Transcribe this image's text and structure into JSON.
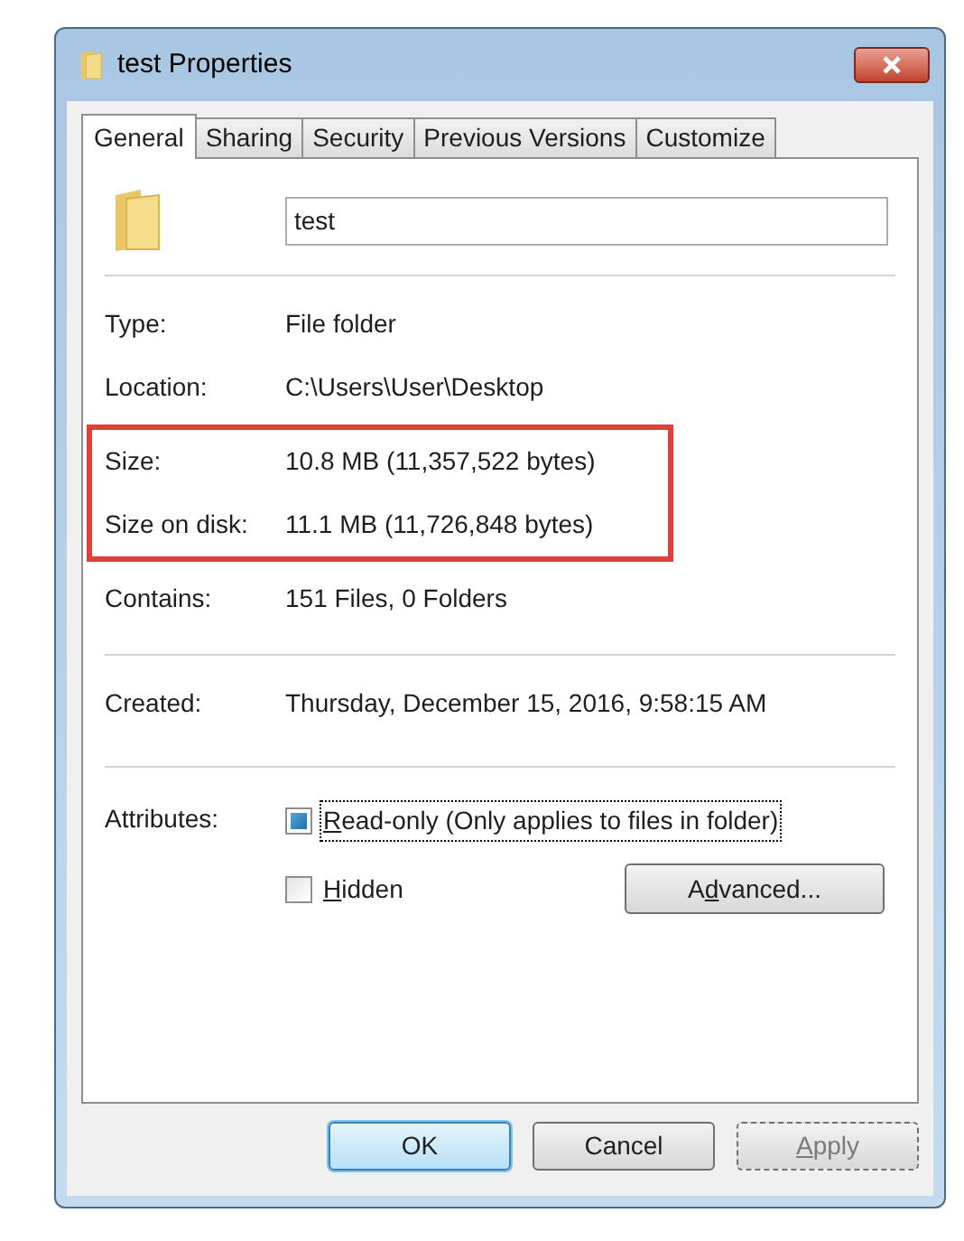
{
  "window": {
    "title": "test Properties"
  },
  "tabs": [
    {
      "label": "General",
      "selected": true
    },
    {
      "label": "Sharing",
      "selected": false
    },
    {
      "label": "Security",
      "selected": false
    },
    {
      "label": "Previous Versions",
      "selected": false
    },
    {
      "label": "Customize",
      "selected": false
    }
  ],
  "name_field": {
    "value": "test"
  },
  "sections": [
    {
      "highlight_groups": [
        {
          "highlighted": false,
          "rows": [
            {
              "label": "Type:",
              "value": "File folder"
            },
            {
              "label": "Location:",
              "value": "C:\\Users\\User\\Desktop"
            }
          ]
        },
        {
          "highlighted": true,
          "rows": [
            {
              "label": "Size:",
              "value": "10.8 MB (11,357,522 bytes)"
            },
            {
              "label": "Size on disk:",
              "value": "11.1 MB (11,726,848 bytes)"
            }
          ]
        },
        {
          "highlighted": false,
          "rows": [
            {
              "label": "Contains:",
              "value": "151 Files, 0 Folders"
            }
          ]
        }
      ]
    },
    {
      "highlight_groups": [
        {
          "highlighted": false,
          "rows": [
            {
              "label": "Created:",
              "value": "Thursday, December 15, 2016, 9:58:15 AM"
            }
          ]
        }
      ]
    }
  ],
  "attributes": {
    "label": "Attributes:",
    "options": [
      {
        "mnemonic": "R",
        "after": "ead-only (Only applies to files in folder)",
        "checked": true,
        "focused": true
      },
      {
        "mnemonic": "H",
        "after": "idden",
        "checked": false,
        "focused": false
      }
    ],
    "advanced_button": {
      "before": "A",
      "mnemonic": "d",
      "after": "vanced..."
    }
  },
  "buttons": [
    {
      "before": "OK",
      "default": true,
      "disabled": false
    },
    {
      "before": "Cancel",
      "default": false,
      "disabled": false
    },
    {
      "mnemonic": "A",
      "after": "pply",
      "default": false,
      "disabled": true
    }
  ]
}
